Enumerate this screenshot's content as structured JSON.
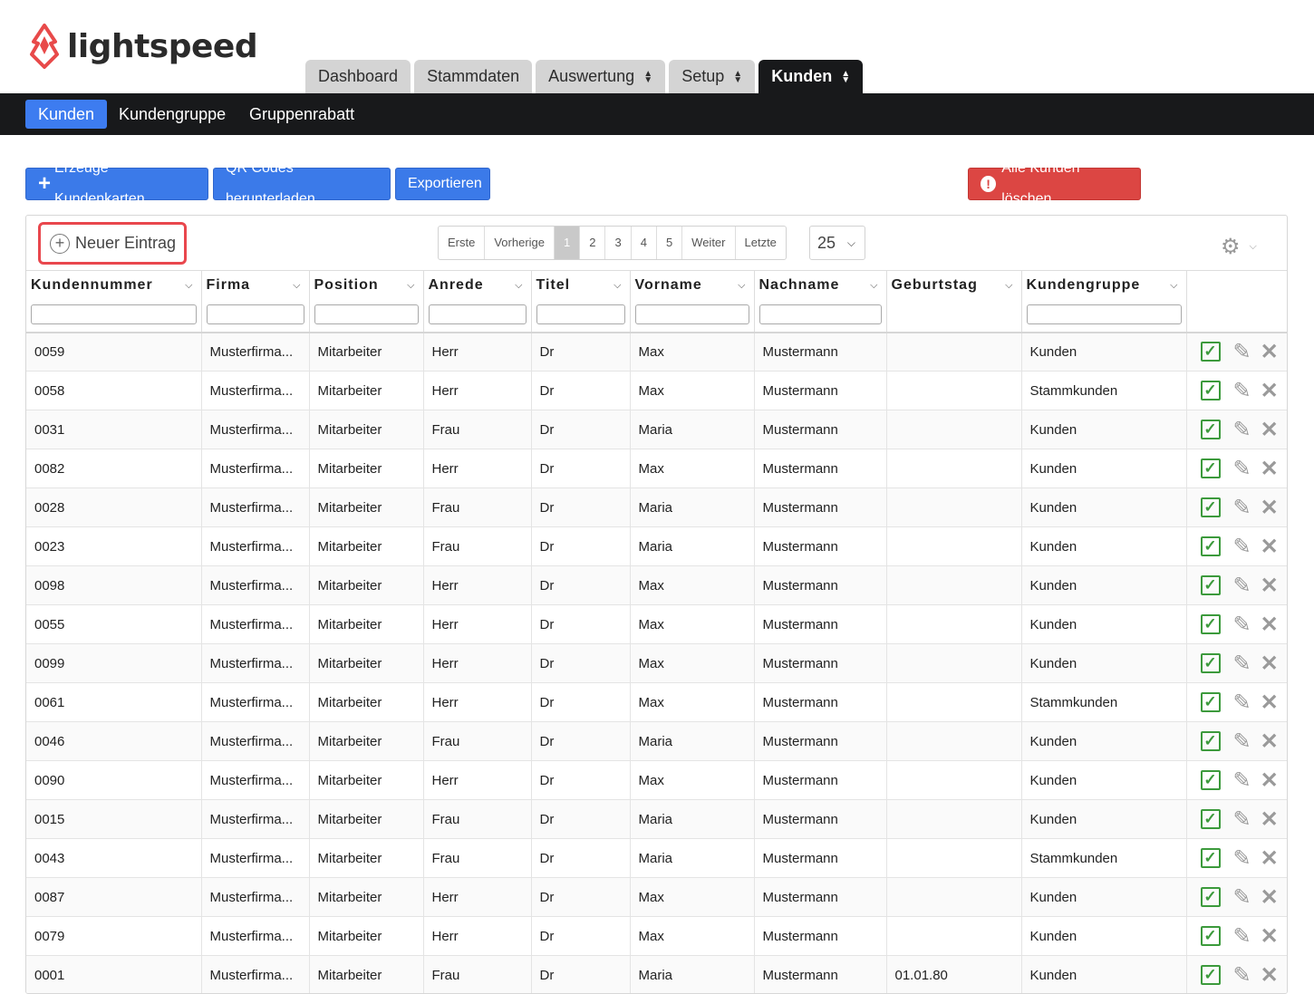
{
  "brand": {
    "name": "lightspeed",
    "color": "#e84a4a"
  },
  "main_tabs": [
    {
      "label": "Dashboard",
      "has_arrows": false
    },
    {
      "label": "Stammdaten",
      "has_arrows": false
    },
    {
      "label": "Auswertung",
      "has_arrows": true
    },
    {
      "label": "Setup",
      "has_arrows": true
    },
    {
      "label": "Kunden",
      "has_arrows": true,
      "active": true
    }
  ],
  "sub_nav": [
    {
      "label": "Kunden",
      "active": true
    },
    {
      "label": "Kundengruppe"
    },
    {
      "label": "Gruppenrabatt"
    }
  ],
  "toolbar": {
    "create_cards": "Erzeuge Kundenkarten",
    "qr_codes": "QR Codes herunterladen",
    "export": "Exportieren",
    "delete_all": "Alle Kunden löschen"
  },
  "panel": {
    "new_entry": "Neuer Eintrag",
    "pager": [
      "Erste",
      "Vorherige",
      "1",
      "2",
      "3",
      "4",
      "5",
      "Weiter",
      "Letzte"
    ],
    "current_page": "1",
    "page_size": "25"
  },
  "columns": [
    "Kundennummer",
    "Firma",
    "Position",
    "Anrede",
    "Titel",
    "Vorname",
    "Nachname",
    "Geburtstag",
    "Kundengruppe"
  ],
  "rows": [
    [
      "0059",
      "Musterfirma...",
      "Mitarbeiter",
      "Herr",
      "Dr",
      "Max",
      "Mustermann",
      "",
      "Kunden"
    ],
    [
      "0058",
      "Musterfirma...",
      "Mitarbeiter",
      "Herr",
      "Dr",
      "Max",
      "Mustermann",
      "",
      "Stammkunden"
    ],
    [
      "0031",
      "Musterfirma...",
      "Mitarbeiter",
      "Frau",
      "Dr",
      "Maria",
      "Mustermann",
      "",
      "Kunden"
    ],
    [
      "0082",
      "Musterfirma...",
      "Mitarbeiter",
      "Herr",
      "Dr",
      "Max",
      "Mustermann",
      "",
      "Kunden"
    ],
    [
      "0028",
      "Musterfirma...",
      "Mitarbeiter",
      "Frau",
      "Dr",
      "Maria",
      "Mustermann",
      "",
      "Kunden"
    ],
    [
      "0023",
      "Musterfirma...",
      "Mitarbeiter",
      "Frau",
      "Dr",
      "Maria",
      "Mustermann",
      "",
      "Kunden"
    ],
    [
      "0098",
      "Musterfirma...",
      "Mitarbeiter",
      "Herr",
      "Dr",
      "Max",
      "Mustermann",
      "",
      "Kunden"
    ],
    [
      "0055",
      "Musterfirma...",
      "Mitarbeiter",
      "Herr",
      "Dr",
      "Max",
      "Mustermann",
      "",
      "Kunden"
    ],
    [
      "0099",
      "Musterfirma...",
      "Mitarbeiter",
      "Herr",
      "Dr",
      "Max",
      "Mustermann",
      "",
      "Kunden"
    ],
    [
      "0061",
      "Musterfirma...",
      "Mitarbeiter",
      "Herr",
      "Dr",
      "Max",
      "Mustermann",
      "",
      "Stammkunden"
    ],
    [
      "0046",
      "Musterfirma...",
      "Mitarbeiter",
      "Frau",
      "Dr",
      "Maria",
      "Mustermann",
      "",
      "Kunden"
    ],
    [
      "0090",
      "Musterfirma...",
      "Mitarbeiter",
      "Herr",
      "Dr",
      "Max",
      "Mustermann",
      "",
      "Kunden"
    ],
    [
      "0015",
      "Musterfirma...",
      "Mitarbeiter",
      "Frau",
      "Dr",
      "Maria",
      "Mustermann",
      "",
      "Kunden"
    ],
    [
      "0043",
      "Musterfirma...",
      "Mitarbeiter",
      "Frau",
      "Dr",
      "Maria",
      "Mustermann",
      "",
      "Stammkunden"
    ],
    [
      "0087",
      "Musterfirma...",
      "Mitarbeiter",
      "Herr",
      "Dr",
      "Max",
      "Mustermann",
      "",
      "Kunden"
    ],
    [
      "0079",
      "Musterfirma...",
      "Mitarbeiter",
      "Herr",
      "Dr",
      "Max",
      "Mustermann",
      "",
      "Kunden"
    ],
    [
      "0001",
      "Musterfirma...",
      "Mitarbeiter",
      "Frau",
      "Dr",
      "Maria",
      "Mustermann",
      "01.01.80",
      "Kunden"
    ]
  ],
  "icons": {
    "row_actions": [
      "check-icon",
      "pencil-icon",
      "close-icon"
    ],
    "settings": "gear-icon"
  }
}
